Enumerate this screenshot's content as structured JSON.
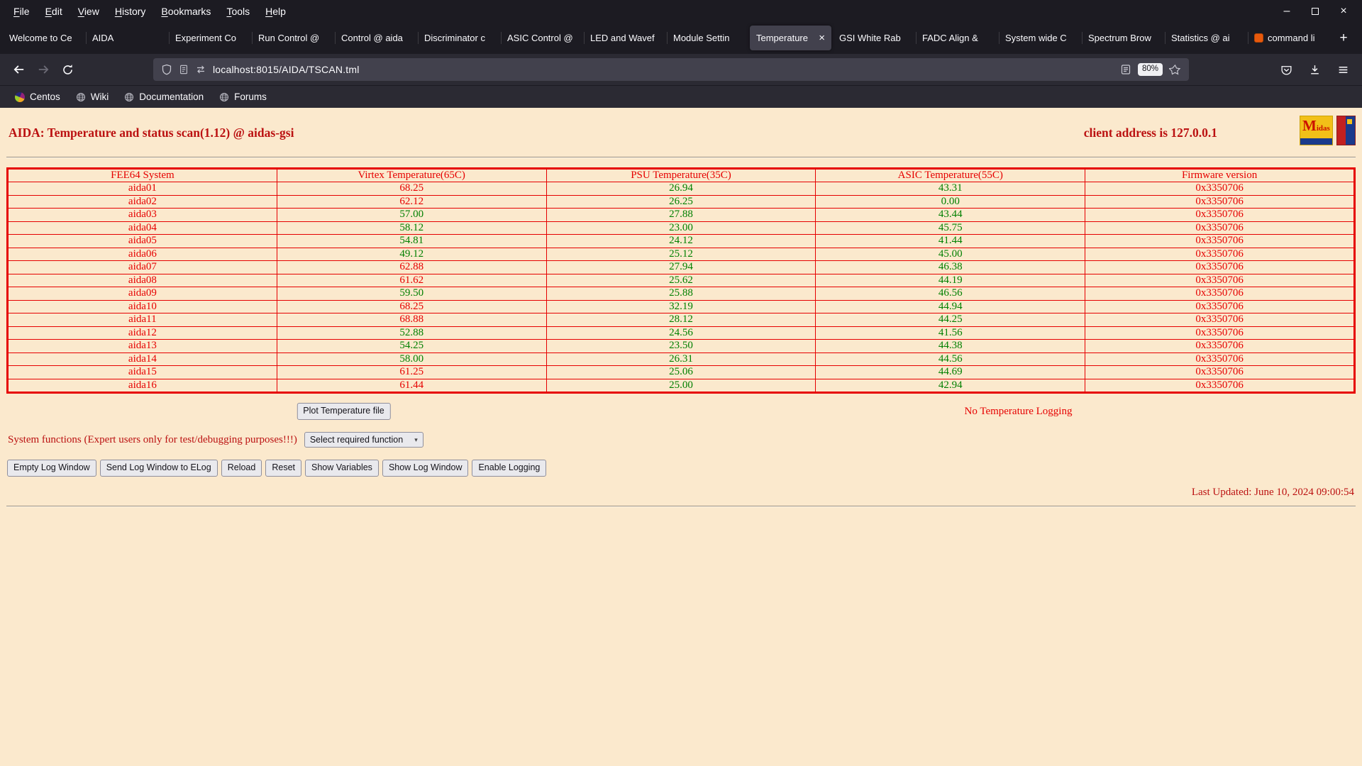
{
  "colors": {
    "page_bg": "#fbe9cd",
    "accent_red": "#bb1111",
    "table_red": "#e60000",
    "value_green": "#008000",
    "chrome_dark": "#1c1b22",
    "chrome_mid": "#2b2a33",
    "chrome_light": "#42414d"
  },
  "browser": {
    "menu_items": [
      "File",
      "Edit",
      "View",
      "History",
      "Bookmarks",
      "Tools",
      "Help"
    ],
    "window_controls": {
      "minimize": "–",
      "close": "×"
    },
    "tab_close_glyph": "×",
    "new_tab_label": "+",
    "tabs": [
      {
        "label": "Welcome to Ce"
      },
      {
        "label": "AIDA"
      },
      {
        "label": "Experiment Co"
      },
      {
        "label": "Run Control @"
      },
      {
        "label": "Control @ aida"
      },
      {
        "label": "Discriminator c"
      },
      {
        "label": "ASIC Control @"
      },
      {
        "label": "LED and Wavef"
      },
      {
        "label": "Module Settin"
      },
      {
        "label": "Temperature",
        "active": true
      },
      {
        "label": "GSI White Rab"
      },
      {
        "label": "FADC Align &"
      },
      {
        "label": "System wide C"
      },
      {
        "label": "Spectrum Brow"
      },
      {
        "label": "Statistics @ ai"
      },
      {
        "label": "command li",
        "favicon": "command"
      }
    ],
    "nav": {
      "url": "localhost:8015/AIDA/TSCAN.tml",
      "zoom": "80%"
    },
    "bookmarks": [
      {
        "label": "Centos",
        "icon": "centos"
      },
      {
        "label": "Wiki",
        "icon": "globe"
      },
      {
        "label": "Documentation",
        "icon": "globe"
      },
      {
        "label": "Forums",
        "icon": "globe"
      }
    ]
  },
  "page": {
    "title": "AIDA: Temperature and status scan(1.12) @ aidas-gsi",
    "client_address": "client address is 127.0.0.1",
    "logos": {
      "midas": "Midas"
    },
    "table": {
      "headers": [
        "FEE64 System",
        "Virtex Temperature(65C)",
        "PSU Temperature(35C)",
        "ASIC Temperature(55C)",
        "Firmware version"
      ],
      "rows": [
        {
          "system": "aida01",
          "virtex": "68.25",
          "virtex_high": true,
          "psu": "26.94",
          "psu_high": false,
          "asic": "43.31",
          "asic_high": false,
          "firmware": "0x3350706"
        },
        {
          "system": "aida02",
          "virtex": "62.12",
          "virtex_high": true,
          "psu": "26.25",
          "psu_high": false,
          "asic": "0.00",
          "asic_high": false,
          "firmware": "0x3350706"
        },
        {
          "system": "aida03",
          "virtex": "57.00",
          "virtex_high": false,
          "psu": "27.88",
          "psu_high": false,
          "asic": "43.44",
          "asic_high": false,
          "firmware": "0x3350706"
        },
        {
          "system": "aida04",
          "virtex": "58.12",
          "virtex_high": false,
          "psu": "23.00",
          "psu_high": false,
          "asic": "45.75",
          "asic_high": false,
          "firmware": "0x3350706"
        },
        {
          "system": "aida05",
          "virtex": "54.81",
          "virtex_high": false,
          "psu": "24.12",
          "psu_high": false,
          "asic": "41.44",
          "asic_high": false,
          "firmware": "0x3350706"
        },
        {
          "system": "aida06",
          "virtex": "49.12",
          "virtex_high": false,
          "psu": "25.12",
          "psu_high": false,
          "asic": "45.00",
          "asic_high": false,
          "firmware": "0x3350706"
        },
        {
          "system": "aida07",
          "virtex": "62.88",
          "virtex_high": true,
          "psu": "27.94",
          "psu_high": false,
          "asic": "46.38",
          "asic_high": false,
          "firmware": "0x3350706"
        },
        {
          "system": "aida08",
          "virtex": "61.62",
          "virtex_high": true,
          "psu": "25.62",
          "psu_high": false,
          "asic": "44.19",
          "asic_high": false,
          "firmware": "0x3350706"
        },
        {
          "system": "aida09",
          "virtex": "59.50",
          "virtex_high": false,
          "psu": "25.88",
          "psu_high": false,
          "asic": "46.56",
          "asic_high": false,
          "firmware": "0x3350706"
        },
        {
          "system": "aida10",
          "virtex": "68.25",
          "virtex_high": true,
          "psu": "32.19",
          "psu_high": false,
          "asic": "44.94",
          "asic_high": false,
          "firmware": "0x3350706"
        },
        {
          "system": "aida11",
          "virtex": "68.88",
          "virtex_high": true,
          "psu": "28.12",
          "psu_high": false,
          "asic": "44.25",
          "asic_high": false,
          "firmware": "0x3350706"
        },
        {
          "system": "aida12",
          "virtex": "52.88",
          "virtex_high": false,
          "psu": "24.56",
          "psu_high": false,
          "asic": "41.56",
          "asic_high": false,
          "firmware": "0x3350706"
        },
        {
          "system": "aida13",
          "virtex": "54.25",
          "virtex_high": false,
          "psu": "23.50",
          "psu_high": false,
          "asic": "44.38",
          "asic_high": false,
          "firmware": "0x3350706"
        },
        {
          "system": "aida14",
          "virtex": "58.00",
          "virtex_high": false,
          "psu": "26.31",
          "psu_high": false,
          "asic": "44.56",
          "asic_high": false,
          "firmware": "0x3350706"
        },
        {
          "system": "aida15",
          "virtex": "61.25",
          "virtex_high": true,
          "psu": "25.06",
          "psu_high": false,
          "asic": "44.69",
          "asic_high": false,
          "firmware": "0x3350706"
        },
        {
          "system": "aida16",
          "virtex": "61.44",
          "virtex_high": true,
          "psu": "25.00",
          "psu_high": false,
          "asic": "42.94",
          "asic_high": false,
          "firmware": "0x3350706"
        }
      ]
    },
    "plot_button_label": "Plot Temperature file",
    "logging_status": "No Temperature Logging",
    "system_functions_label": "System functions (Expert users only for test/debugging purposes!!!)",
    "function_select_value": "Select required function",
    "action_buttons": [
      "Empty Log Window",
      "Send Log Window to ELog",
      "Reload",
      "Reset",
      "Show Variables",
      "Show Log Window",
      "Enable Logging"
    ],
    "last_updated": "Last Updated: June 10, 2024 09:00:54"
  }
}
